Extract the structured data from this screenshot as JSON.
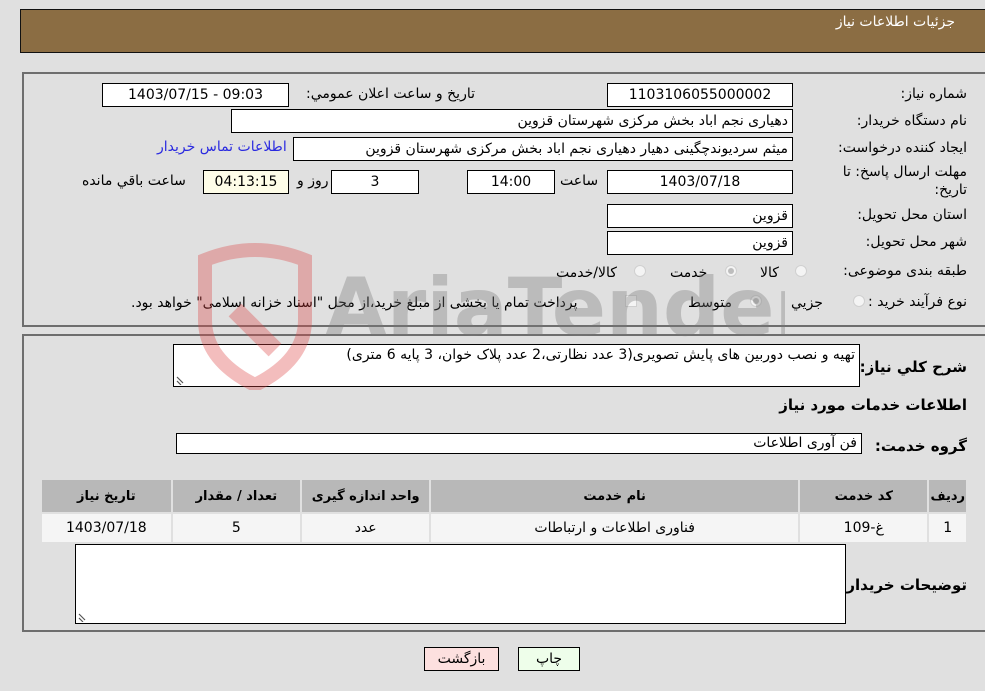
{
  "header": {
    "title": "جزئیات اطلاعات نیاز"
  },
  "form": {
    "need_number_label": "شماره نیاز:",
    "need_number": "1103106055000002",
    "announce_label": "تاريخ و ساعت اعلان عمومي:",
    "announce_value": "1403/07/15 - 09:03",
    "buyer_org_label": "نام دستگاه خریدار:",
    "buyer_org": "دهیاری نجم اباد بخش مرکزی شهرستان قزوین",
    "creator_label": "ایجاد کننده درخواست:",
    "creator": "میثم سردیوندچگینی دهیار دهیاری نجم اباد بخش مرکزی شهرستان قزوین",
    "contact_link": "اطلاعات تماس خریدار",
    "deadline_label_line1": "مهلت ارسال پاسخ: تا",
    "deadline_label_line2": "تاریخ:",
    "deadline_date": "1403/07/18",
    "time_label": "ساعت",
    "deadline_time": "14:00",
    "days_value": "3",
    "days_label": "روز و",
    "remaining_time": "04:13:15",
    "remaining_label": "ساعت باقي مانده",
    "province_label": "استان محل تحویل:",
    "province": "قزوین",
    "city_label": "شهر محل تحویل:",
    "city": "قزوین",
    "category_label": "طبقه بندی موضوعی:",
    "category_options": [
      {
        "label": "کالا",
        "selected": false
      },
      {
        "label": "خدمت",
        "selected": true
      },
      {
        "label": "کالا/خدمت",
        "selected": false
      }
    ],
    "process_label": "نوع فرآیند خرید :",
    "process_options": [
      {
        "label": "جزيي",
        "selected": false
      },
      {
        "label": "متوسط",
        "selected": true
      }
    ],
    "treasury_checkbox_label": "پرداخت تمام یا بخشی از مبلغ خرید،از محل \"اسناد خزانه اسلامی\" خواهد بود.",
    "treasury_checked": false
  },
  "details": {
    "description_label": "شرح کلي نياز:",
    "description": "تهیه و نصب دوربین های پایش تصویری(3 عدد نظارتی،2 عدد پلاک خوان، 3 پایه 6 متری)",
    "services_heading": "اطلاعات خدمات مورد نياز",
    "service_group_label": "گروه خدمت:",
    "service_group": "فن آوری اطلاعات",
    "table": {
      "headers": [
        "رديف",
        "کد خدمت",
        "نام خدمت",
        "واحد اندازه گيری",
        "تعداد / مقدار",
        "تاريخ نياز"
      ],
      "rows": [
        [
          "1",
          "غ-109",
          "فناوری اطلاعات و ارتباطات",
          "عدد",
          "5",
          "1403/07/18"
        ]
      ]
    },
    "buyer_notes_label": "توضيحات خريدار:",
    "buyer_notes": ""
  },
  "buttons": {
    "print": "چاپ",
    "back": "بازگشت"
  },
  "watermark": {
    "text": "AriaTender.neT"
  }
}
